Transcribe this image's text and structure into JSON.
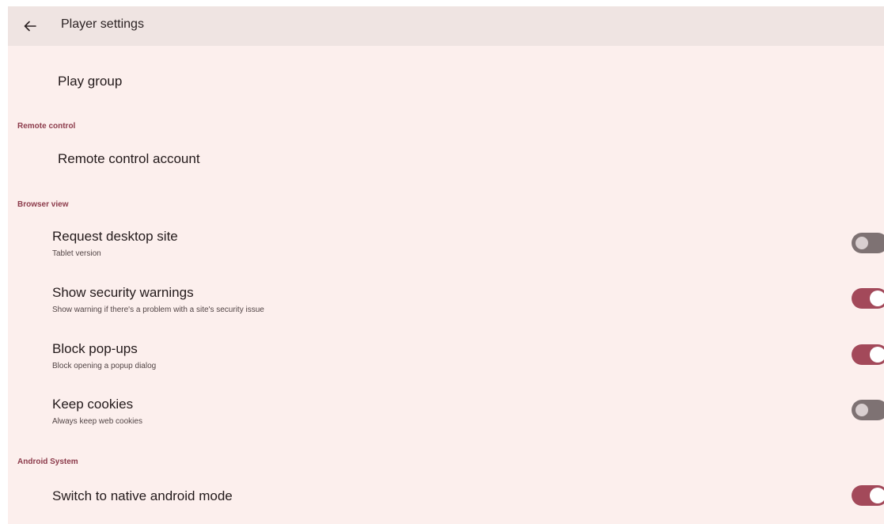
{
  "header": {
    "title": "Player settings",
    "back_icon": "arrow-back-icon"
  },
  "items": {
    "play_group": {
      "title": "Play group"
    },
    "remote_control_account": {
      "title": "Remote control account"
    },
    "request_desktop_site": {
      "title": "Request desktop site",
      "subtitle": "Tablet version",
      "enabled": false
    },
    "show_security_warnings": {
      "title": "Show security warnings",
      "subtitle": "Show warning if there's a problem with a site's security issue",
      "enabled": true
    },
    "block_popups": {
      "title": "Block pop-ups",
      "subtitle": "Block opening a popup dialog",
      "enabled": true
    },
    "keep_cookies": {
      "title": "Keep cookies",
      "subtitle": "Always keep web cookies",
      "enabled": false
    },
    "native_android_mode": {
      "title": "Switch to native android mode",
      "enabled": true
    }
  },
  "sections": {
    "remote_control": "Remote control",
    "browser_view": "Browser view",
    "android_system": "Android System"
  },
  "colors": {
    "background": "#fcefed",
    "app_bar": "#efe4e2",
    "accent": "#a3495a",
    "section_header": "#8c3b4b",
    "switch_off_track": "#7e7273"
  }
}
